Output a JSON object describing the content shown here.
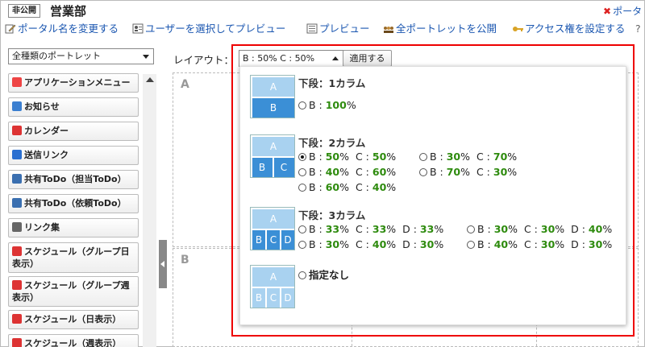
{
  "header": {
    "badge": "非公開",
    "title": "営業部",
    "close_label": "ポータ"
  },
  "toolbar": {
    "items": [
      {
        "label": "ポータル名を変更する"
      },
      {
        "label": "ユーザーを選択してプレビュー"
      },
      {
        "label": "プレビュー"
      },
      {
        "label": "全ポートレットを公開"
      },
      {
        "label": "アクセス権を設定する"
      }
    ]
  },
  "sidebar": {
    "filter": "全種類のポートレット",
    "items": [
      {
        "label": "アプリケーションメニュー",
        "icon": "apps-icon"
      },
      {
        "label": "お知らせ",
        "icon": "info-icon"
      },
      {
        "label": "カレンダー",
        "icon": "calendar-icon"
      },
      {
        "label": "送信リンク",
        "icon": "arrow-icon"
      },
      {
        "label": "共有ToDo（担当ToDo）",
        "icon": "globe-icon"
      },
      {
        "label": "共有ToDo（依頼ToDo）",
        "icon": "globe-icon"
      },
      {
        "label": "リンク集",
        "icon": "link-icon"
      },
      {
        "label": "スケジュール（グループ日表示）",
        "icon": "calendar-icon"
      },
      {
        "label": "スケジュール（グループ週表示）",
        "icon": "calendar-icon"
      },
      {
        "label": "スケジュール（日表示）",
        "icon": "calendar-icon"
      },
      {
        "label": "スケジュール（週表示）",
        "icon": "calendar-icon"
      }
    ]
  },
  "layout": {
    "label": "レイアウト：",
    "selected": "B : 50% C : 50%",
    "apply": "適用する",
    "zoneA": "A",
    "zoneB": "B"
  },
  "dropdown": {
    "g1": {
      "title": "下段：1カラム",
      "opts": [
        {
          "b": "100%"
        }
      ]
    },
    "g2": {
      "title": "下段：2カラム",
      "opts": [
        {
          "b": "50%",
          "c": "50%",
          "checked": true
        },
        {
          "b": "30%",
          "c": "70%"
        },
        {
          "b": "40%",
          "c": "60%"
        },
        {
          "b": "70%",
          "c": "30%"
        },
        {
          "b": "60%",
          "c": "40%"
        }
      ]
    },
    "g3": {
      "title": "下段：3カラム",
      "opts": [
        {
          "b": "33%",
          "c": "33%",
          "d": "33%"
        },
        {
          "b": "30%",
          "c": "30%",
          "d": "40%"
        },
        {
          "b": "30%",
          "c": "40%",
          "d": "30%"
        },
        {
          "b": "40%",
          "c": "30%",
          "d": "30%"
        }
      ]
    },
    "g4": {
      "title": "指定なし"
    },
    "letters": {
      "a": "A",
      "b": "B",
      "c": "C",
      "d": "D"
    },
    "prefix": {
      "b": "B : ",
      "c": "C : ",
      "d": "D : "
    }
  },
  "colors": {
    "accent": "#3b8fd6",
    "light": "#a9d2f0",
    "green": "#2e8b0e",
    "red": "#e00000",
    "link": "#1a56b0"
  }
}
